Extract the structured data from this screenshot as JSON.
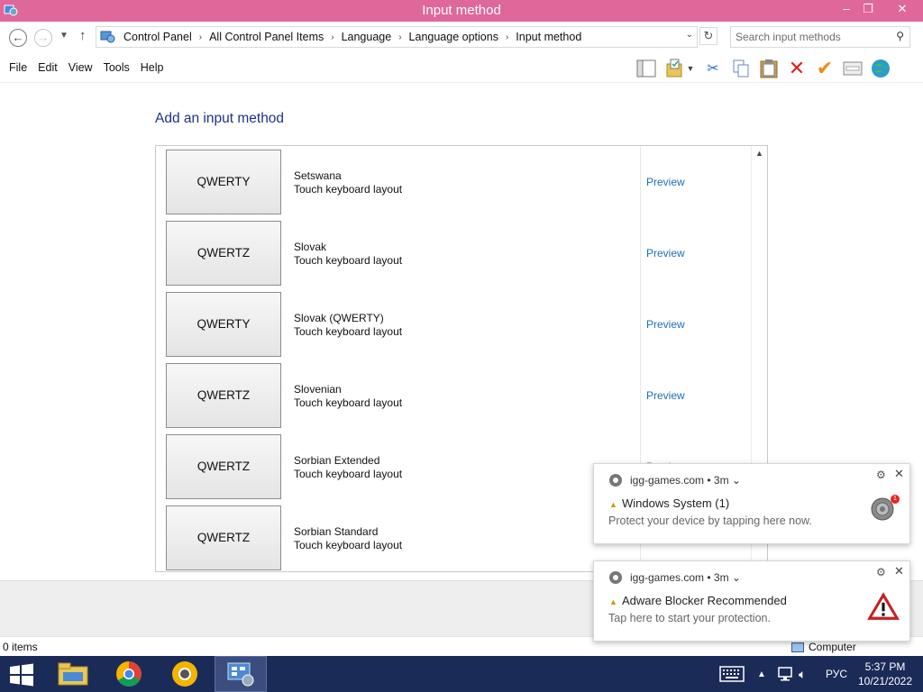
{
  "window": {
    "title": "Input method",
    "controls": {
      "minimize": "–",
      "maximize": "❐",
      "close": "✕"
    }
  },
  "address_bar": {
    "breadcrumbs": [
      "Control Panel",
      "All Control Panel Items",
      "Language",
      "Language options",
      "Input method"
    ],
    "search_placeholder": "Search input methods"
  },
  "menu": [
    "File",
    "Edit",
    "View",
    "Tools",
    "Help"
  ],
  "toolbar_icons": [
    "layout-icon",
    "folder-options-icon",
    "cut-icon",
    "copy-icon",
    "paste-icon",
    "delete-icon",
    "check-icon",
    "properties-icon",
    "globe-icon"
  ],
  "content": {
    "heading": "Add an input method",
    "preview_label": "Preview",
    "items": [
      {
        "layout": "QWERTY",
        "name": "Setswana",
        "type": "Touch keyboard layout"
      },
      {
        "layout": "QWERTZ",
        "name": "Slovak",
        "type": "Touch keyboard layout"
      },
      {
        "layout": "QWERTY",
        "name": "Slovak (QWERTY)",
        "type": "Touch keyboard layout"
      },
      {
        "layout": "QWERTZ",
        "name": "Slovenian",
        "type": "Touch keyboard layout"
      },
      {
        "layout": "QWERTZ",
        "name": "Sorbian Extended",
        "type": "Touch keyboard layout"
      },
      {
        "layout": "QWERTZ",
        "name": "Sorbian Standard",
        "type": "Touch keyboard layout"
      }
    ]
  },
  "status_bar": {
    "items": "0 items",
    "location": "Computer"
  },
  "notifications": [
    {
      "source": "igg-games.com",
      "age": "3m",
      "title": "Windows System (1)",
      "message": "Protect your device by tapping here now.",
      "badge": "1"
    },
    {
      "source": "igg-games.com",
      "age": "3m",
      "title": "Adware Blocker Recommended",
      "message": "Tap here to start your protection."
    }
  ],
  "taskbar": {
    "apps": [
      "file-explorer",
      "chrome",
      "chrome-canary",
      "control-panel"
    ],
    "language": "РУС",
    "time": "5:37 PM",
    "date": "10/21/2022"
  },
  "colors": {
    "titlebar": "#e0679a",
    "heading": "#1e3287",
    "link": "#1d6fb5",
    "taskbar": "#1b2b57"
  }
}
